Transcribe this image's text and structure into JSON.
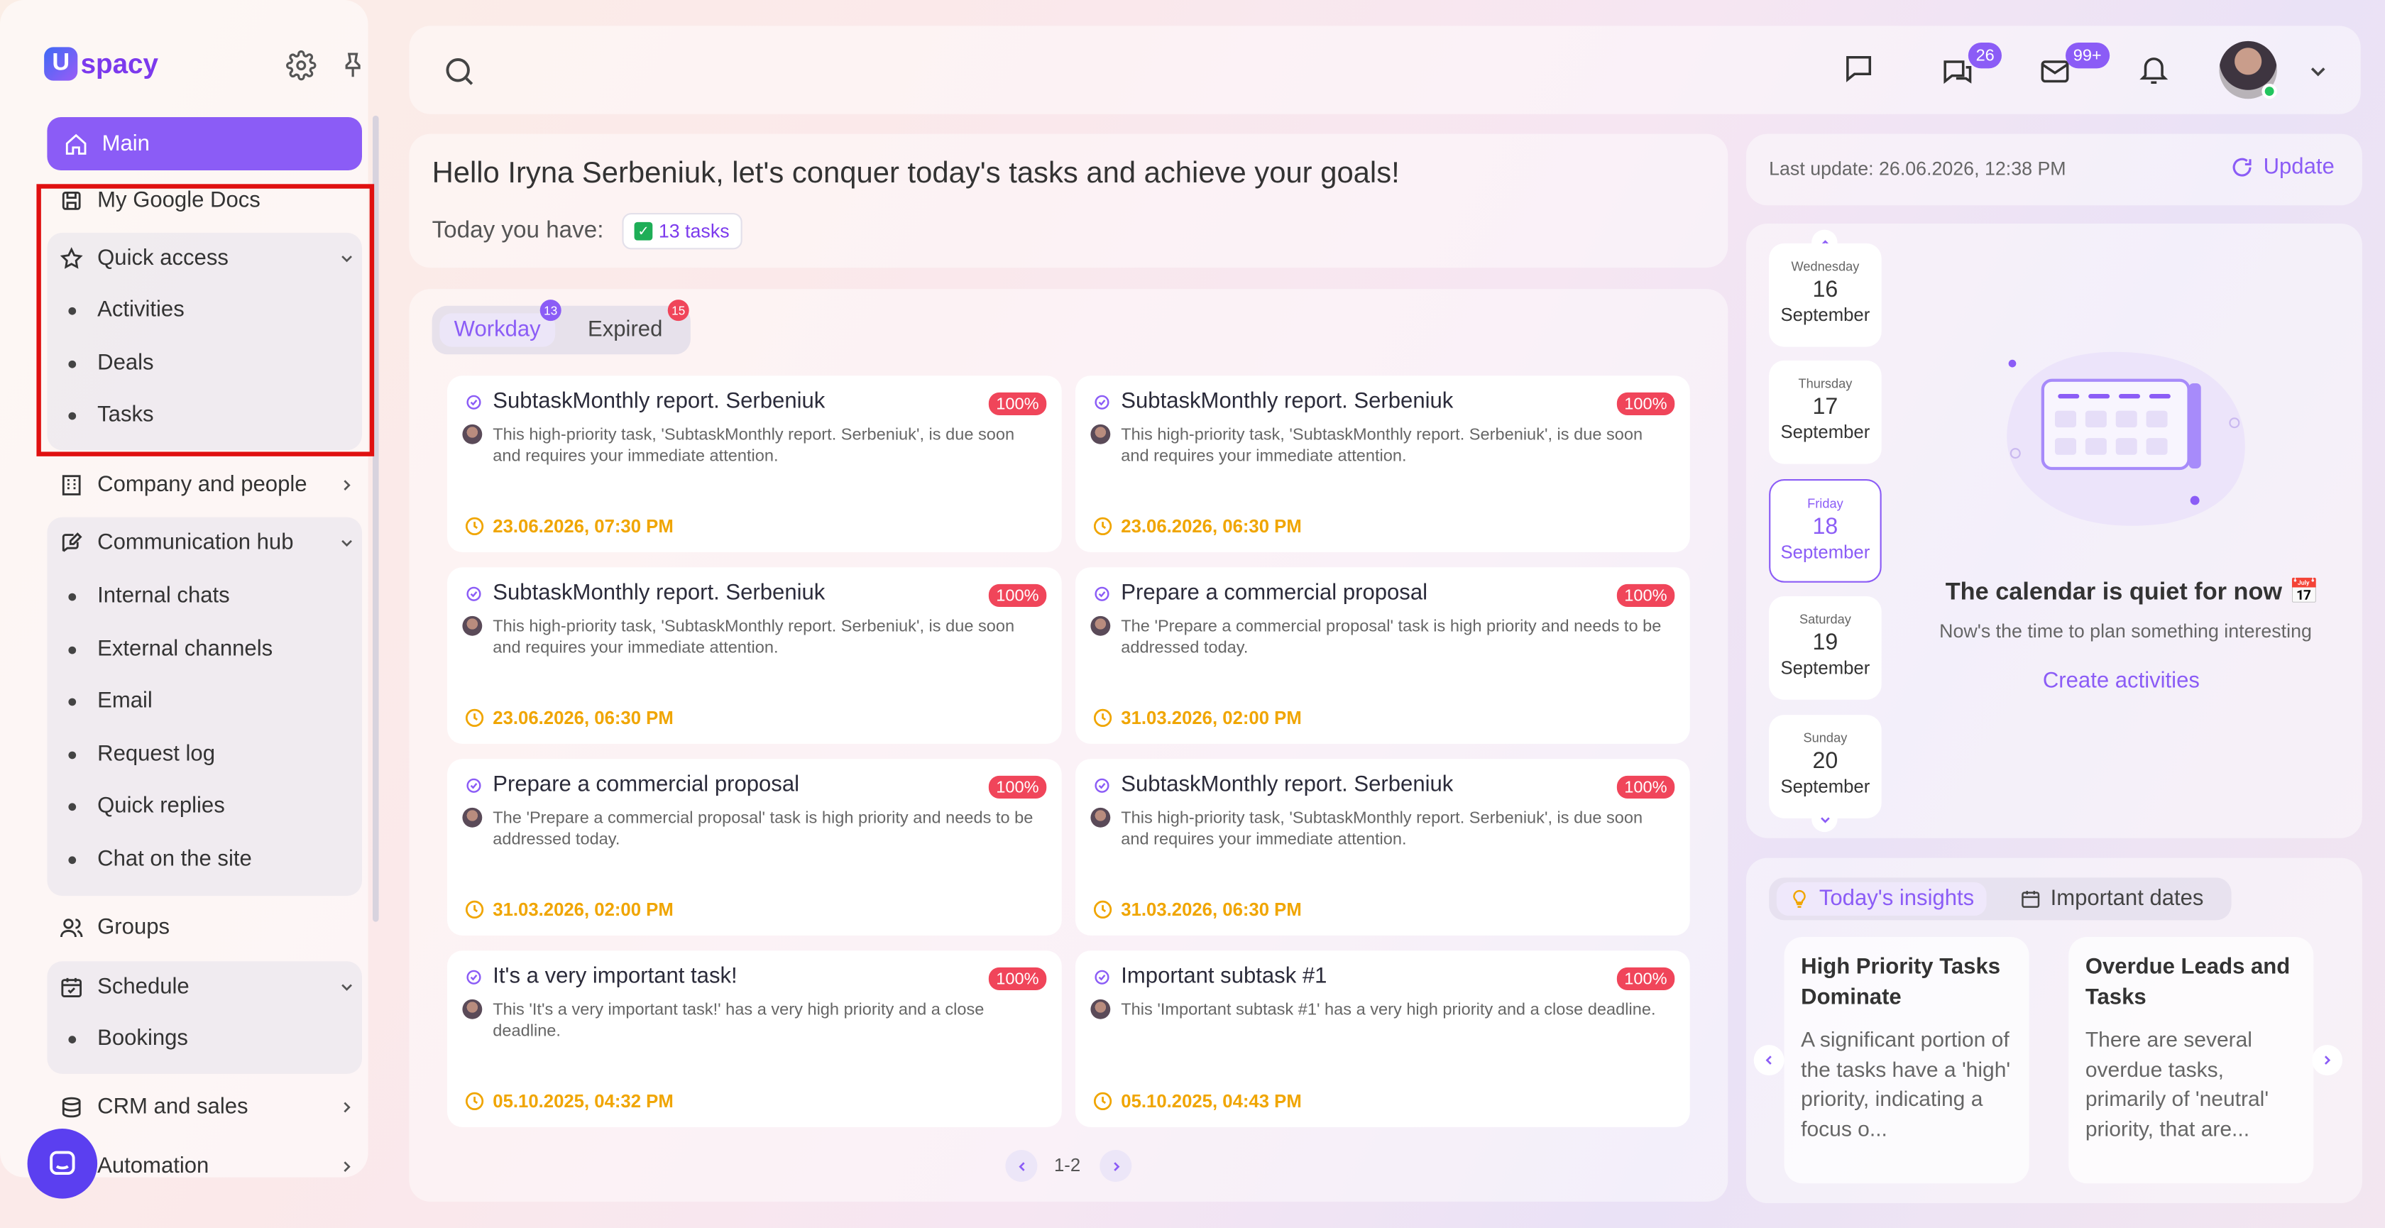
{
  "brand": {
    "logo_text": "spacy",
    "logo_letter": "U"
  },
  "sidebar": {
    "main": "Main",
    "google_docs": "My Google Docs",
    "quick_access": {
      "label": "Quick access",
      "items": [
        "Activities",
        "Deals",
        "Tasks"
      ]
    },
    "company": "Company and people",
    "comm_hub": {
      "label": "Communication hub",
      "items": [
        "Internal chats",
        "External channels",
        "Email",
        "Request log",
        "Quick replies",
        "Chat on the site"
      ]
    },
    "groups": "Groups",
    "schedule": {
      "label": "Schedule",
      "items": [
        "Bookings"
      ]
    },
    "crm": "CRM and sales",
    "automation": "Automation"
  },
  "header": {
    "chats_badge": "26",
    "mail_badge": "99+"
  },
  "greeting": {
    "title": "Hello Iryna Serbeniuk, let's conquer today's tasks and achieve your goals!",
    "today_label": "Today you have:",
    "tasks_count": "13 tasks"
  },
  "task_tabs": [
    {
      "label": "Workday",
      "count": "13"
    },
    {
      "label": "Expired",
      "count": "15"
    }
  ],
  "tasks": [
    {
      "title": "SubtaskMonthly report. Serbeniuk",
      "pct": "100%",
      "desc": "This high-priority task, 'SubtaskMonthly report. Serbeniuk', is due soon and requires your immediate attention.",
      "date": "23.06.2026, 07:30 PM"
    },
    {
      "title": "SubtaskMonthly report. Serbeniuk",
      "pct": "100%",
      "desc": "This high-priority task, 'SubtaskMonthly report. Serbeniuk', is due soon and requires your immediate attention.",
      "date": "23.06.2026, 06:30 PM"
    },
    {
      "title": "SubtaskMonthly report. Serbeniuk",
      "pct": "100%",
      "desc": "This high-priority task, 'SubtaskMonthly report. Serbeniuk', is due soon and requires your immediate attention.",
      "date": "23.06.2026, 06:30 PM"
    },
    {
      "title": "Prepare a commercial proposal",
      "pct": "100%",
      "desc": "The 'Prepare a commercial proposal' task is high priority and needs to be addressed today.",
      "date": "31.03.2026, 02:00 PM"
    },
    {
      "title": "Prepare a commercial proposal",
      "pct": "100%",
      "desc": "The 'Prepare a commercial proposal' task is high priority and needs to be addressed today.",
      "date": "31.03.2026, 02:00 PM"
    },
    {
      "title": "SubtaskMonthly report. Serbeniuk",
      "pct": "100%",
      "desc": "This high-priority task, 'SubtaskMonthly report. Serbeniuk', is due soon and requires your immediate attention.",
      "date": "31.03.2026, 06:30 PM"
    },
    {
      "title": "It's a very important task!",
      "pct": "100%",
      "desc": "This 'It's a very important task!' has a very high priority and a close deadline.",
      "date": "05.10.2025, 04:32 PM"
    },
    {
      "title": "Important subtask #1",
      "pct": "100%",
      "desc": "This 'Important subtask #1' has a very high priority and a close deadline.",
      "date": "05.10.2025, 04:43 PM"
    }
  ],
  "pagination": {
    "label": "1-2"
  },
  "update": {
    "last": "Last update: 26.06.2026, 12:38 PM",
    "button": "Update"
  },
  "calendar": {
    "days": [
      {
        "weekday": "Wednesday",
        "day": "16",
        "month": "September",
        "selected": false
      },
      {
        "weekday": "Thursday",
        "day": "17",
        "month": "September",
        "selected": false
      },
      {
        "weekday": "Friday",
        "day": "18",
        "month": "September",
        "selected": true
      },
      {
        "weekday": "Saturday",
        "day": "19",
        "month": "September",
        "selected": false
      },
      {
        "weekday": "Sunday",
        "day": "20",
        "month": "September",
        "selected": false
      }
    ],
    "empty_title": "The calendar is quiet for now 📅",
    "empty_sub": "Now's the time to plan something interesting",
    "create": "Create activities"
  },
  "insights": {
    "tabs": [
      "Today's insights",
      "Important dates"
    ],
    "cards": [
      {
        "title": "High Priority Tasks Dominate",
        "body": "A significant portion of the tasks have a 'high' priority, indicating a focus o..."
      },
      {
        "title": "Overdue Leads and Tasks",
        "body": "There are several overdue tasks, primarily of 'neutral' priority, that are..."
      }
    ]
  },
  "colors": {
    "accent": "#8b5cf6",
    "danger": "#f0455a",
    "date": "#f0a500"
  }
}
